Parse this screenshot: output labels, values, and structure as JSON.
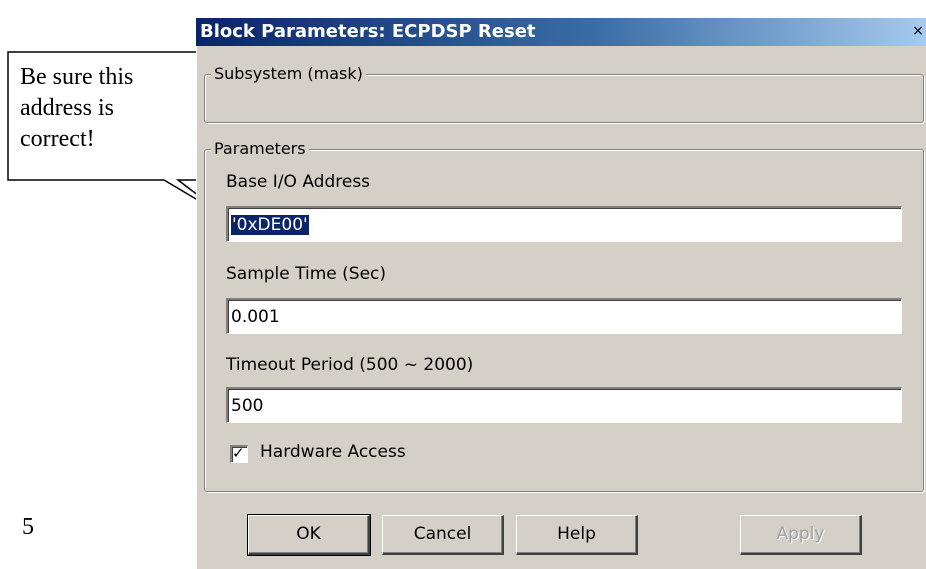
{
  "dialog": {
    "title": "Block Parameters: ECPDSP Reset",
    "close_label": "×"
  },
  "subsystem": {
    "label": "Subsystem (mask)"
  },
  "parameters": {
    "label": "Parameters",
    "base_address": {
      "label": "Base I/O Address",
      "value": "'0xDE00'"
    },
    "sample_time": {
      "label": "Sample Time (Sec)",
      "value": "0.001"
    },
    "timeout": {
      "label": "Timeout Period (500 ~ 2000)",
      "value": "500"
    },
    "hardware_access": {
      "label": "Hardware Access",
      "checked": true
    }
  },
  "buttons": {
    "ok": "OK",
    "cancel": "Cancel",
    "help": "Help",
    "apply": "Apply"
  },
  "callout": {
    "text": "Be sure this address is correct!"
  },
  "page_number": "5"
}
